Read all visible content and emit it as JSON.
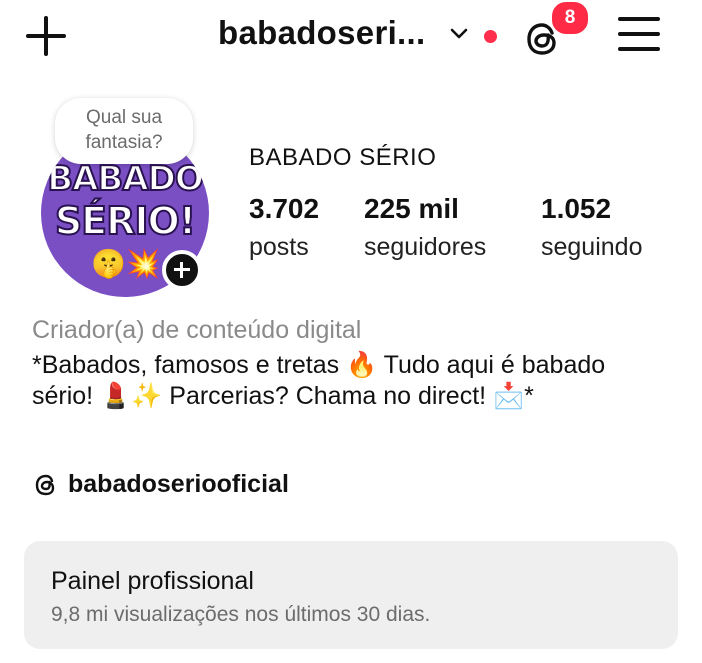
{
  "header": {
    "username": "babadoseri...",
    "notification_count": "8"
  },
  "avatar": {
    "logo_line1": "BABADO",
    "logo_line2": "SÉRIO!",
    "logo_emoji": "🤫💥",
    "note_bubble": "Qual sua fantasia?"
  },
  "profile": {
    "display_name": "BABADO SÉRIO",
    "stats": [
      {
        "value": "3.702",
        "label": "posts"
      },
      {
        "value": "225 mil",
        "label": "seguidores"
      },
      {
        "value": "1.052",
        "label": "seguindo"
      }
    ],
    "category": "Criador(a) de conteúdo digital",
    "bio": "*Babados, famosos e tretas 🔥 Tudo aqui é babado sério! 💄✨ Parcerias? Chama no direct! 📩*",
    "threads_handle": "babadoseriooficial"
  },
  "professional_dashboard": {
    "title": "Painel profissional",
    "subtitle": "9,8 mi visualizações nos últimos 30 dias."
  },
  "colors": {
    "badge": "#ff2b46",
    "avatar_bg": "#7a4fc4",
    "muted_text": "#6c6c6c",
    "panel_bg": "#efefef"
  }
}
